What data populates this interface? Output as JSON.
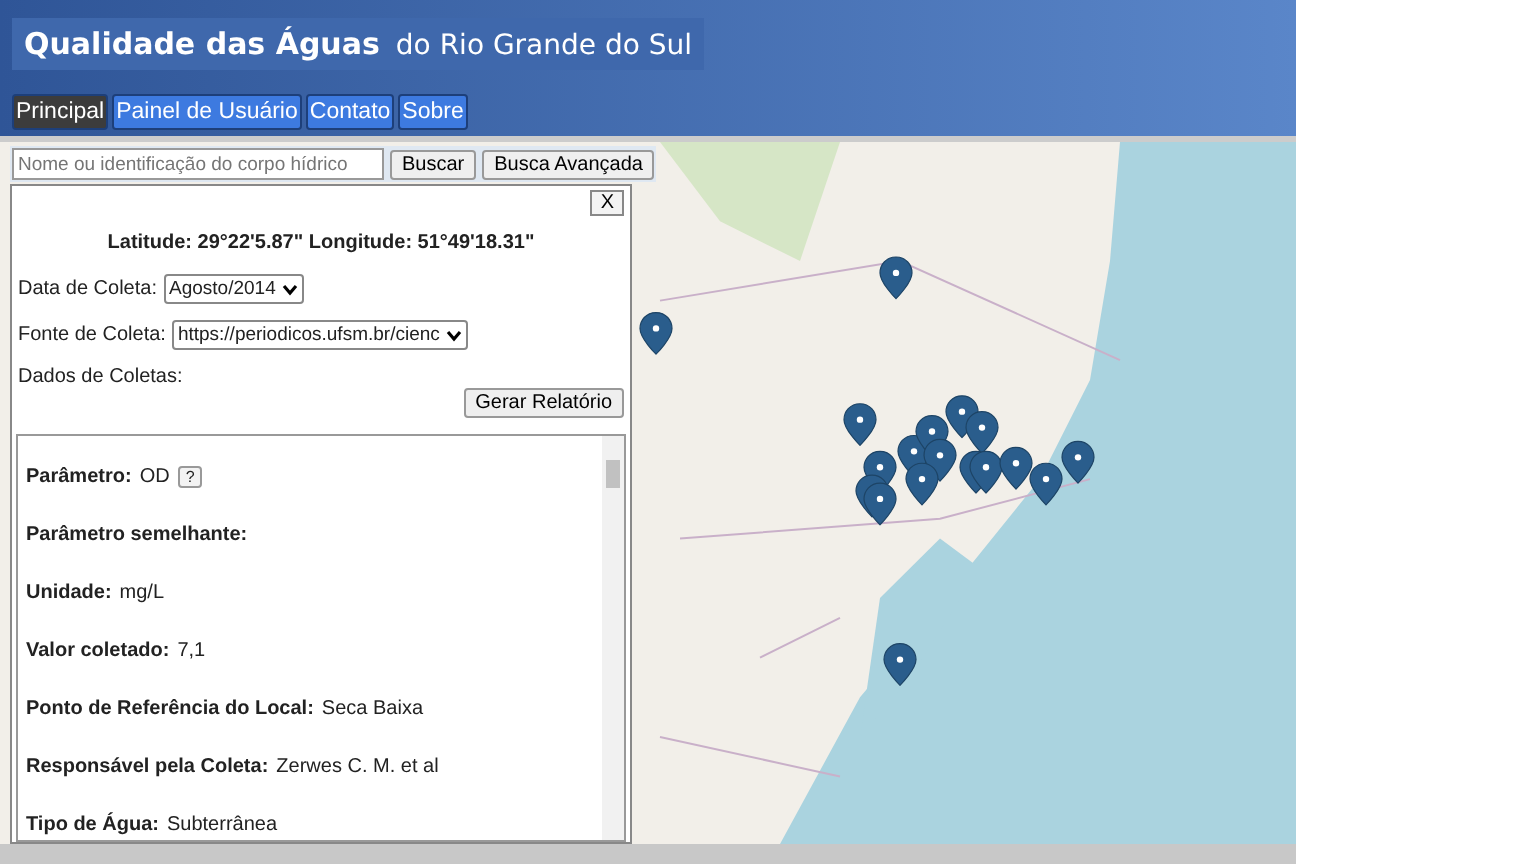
{
  "header": {
    "title": "Qualidade das Águas",
    "subtitle": "do Rio Grande do Sul"
  },
  "nav": [
    {
      "label": "Principal",
      "selected": true
    },
    {
      "label": "Painel de Usuário",
      "selected": false
    },
    {
      "label": "Contato",
      "selected": false
    },
    {
      "label": "Sobre",
      "selected": false
    }
  ],
  "search": {
    "placeholder": "Nome ou identificação do corpo hídrico",
    "buttons": [
      "Buscar",
      "Busca Avançada"
    ]
  },
  "panel": {
    "close": "X",
    "coordinates": "Latitude: 29°22'5.87\" Longitude: 51°49'18.31\"",
    "fields": [
      {
        "label": "Data de Coleta:",
        "value": "Agosto/2014"
      },
      {
        "label": "Fonte de Coleta:",
        "value": "https://periodicos.ufsm.br/cienc"
      }
    ],
    "data_label": "Dados de Coletas:",
    "report_button": "Gerar Relatório",
    "details": [
      {
        "label": "Parâmetro:",
        "value": "OD",
        "help": "?"
      },
      {
        "label": "Parâmetro semelhante:"
      },
      {
        "label": "Unidade:",
        "value": "mg/L"
      },
      {
        "label": "Valor coletado:",
        "value": "7,1"
      },
      {
        "label": "Ponto de Referência do Local:",
        "value": "Seca Baixa"
      },
      {
        "label": "Responsável pela Coleta:",
        "value": "Zerwes C. M. et al"
      },
      {
        "label": "Tipo de Água:",
        "value": "Subterrânea"
      }
    ]
  }
}
